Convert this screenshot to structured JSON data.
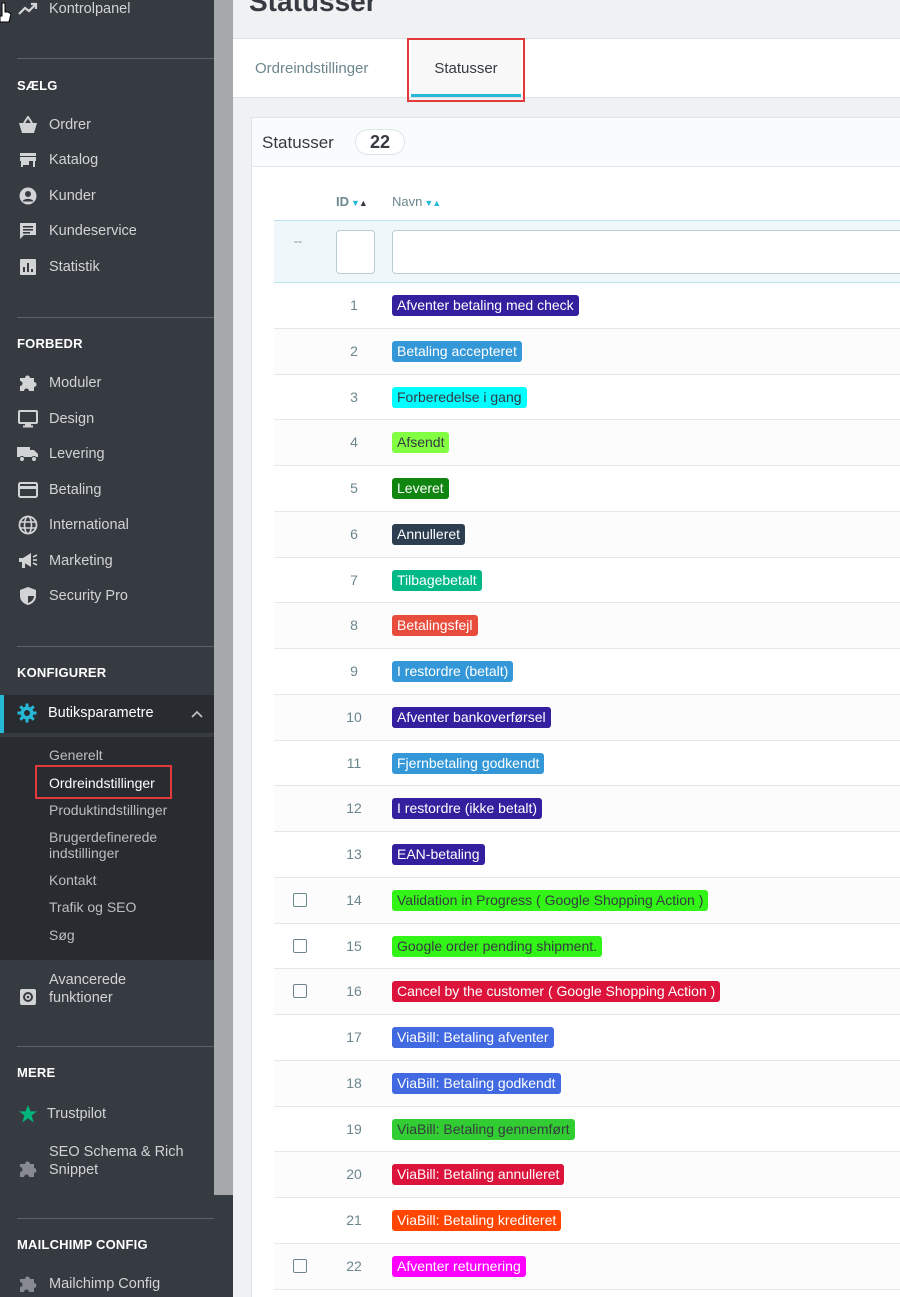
{
  "page": {
    "title": "Statusser"
  },
  "tabs": [
    {
      "label": "Ordreindstillinger"
    },
    {
      "label": "Statusser"
    }
  ],
  "sidebar": {
    "top_item": {
      "label": "Kontrolpanel",
      "icon": "trending-up-icon"
    },
    "sections": [
      {
        "title": "SÆLG",
        "items": [
          {
            "label": "Ordrer",
            "icon": "basket-icon"
          },
          {
            "label": "Katalog",
            "icon": "store-icon"
          },
          {
            "label": "Kunder",
            "icon": "account-icon"
          },
          {
            "label": "Kundeservice",
            "icon": "chat-icon"
          },
          {
            "label": "Statistik",
            "icon": "bar-chart-icon"
          }
        ]
      },
      {
        "title": "FORBEDR",
        "items": [
          {
            "label": "Moduler",
            "icon": "puzzle-icon"
          },
          {
            "label": "Design",
            "icon": "desktop-icon"
          },
          {
            "label": "Levering",
            "icon": "truck-icon"
          },
          {
            "label": "Betaling",
            "icon": "credit-card-icon"
          },
          {
            "label": "International",
            "icon": "globe-icon"
          },
          {
            "label": "Marketing",
            "icon": "megaphone-icon"
          },
          {
            "label": "Security Pro",
            "icon": "shield-icon"
          }
        ]
      },
      {
        "title": "KONFIGURER"
      },
      {
        "title": "MERE",
        "items": [
          {
            "label": "Trustpilot",
            "icon": "star-icon"
          },
          {
            "label": "SEO Schema & Rich Snippet",
            "icon": "puzzle-icon"
          }
        ]
      },
      {
        "title": "MAILCHIMP CONFIG",
        "items": [
          {
            "label": "Mailchimp Config",
            "icon": "puzzle-icon"
          }
        ]
      }
    ],
    "active": {
      "label": "Butiksparametre",
      "icon": "gear-icon"
    },
    "subitems": [
      "Generelt",
      "Ordreindstillinger",
      "Produktindstillinger",
      "Brugerdefinerede indstillinger",
      "Kontakt",
      "Trafik og SEO",
      "Søg"
    ],
    "advanced": {
      "label": "Avancerede funktioner",
      "icon": "settings-box-icon"
    }
  },
  "panel": {
    "title": "Statusser",
    "count": "22"
  },
  "table": {
    "columns": [
      "ID",
      "Navn"
    ],
    "filter_placeholder": "--",
    "rows": [
      {
        "id": "1",
        "name": "Afventer betaling med check",
        "color": "#34209e",
        "text": "#ffffff",
        "checkbox": false
      },
      {
        "id": "2",
        "name": "Betaling accepteret",
        "color": "#3498d8",
        "text": "#ffffff",
        "checkbox": false
      },
      {
        "id": "3",
        "name": "Forberedelse i gang",
        "color": "#00ffff",
        "text": "#363a41",
        "checkbox": false
      },
      {
        "id": "4",
        "name": "Afsendt",
        "color": "#82ff40",
        "text": "#363a41",
        "checkbox": false
      },
      {
        "id": "5",
        "name": "Leveret",
        "color": "#108510",
        "text": "#ffffff",
        "checkbox": false
      },
      {
        "id": "6",
        "name": "Annulleret",
        "color": "#2c3e50",
        "text": "#ffffff",
        "checkbox": false
      },
      {
        "id": "7",
        "name": "Tilbagebetalt",
        "color": "#01b887",
        "text": "#ffffff",
        "checkbox": false
      },
      {
        "id": "8",
        "name": "Betalingsfejl",
        "color": "#e74c3c",
        "text": "#ffffff",
        "checkbox": false
      },
      {
        "id": "9",
        "name": "I restordre (betalt)",
        "color": "#3498d8",
        "text": "#ffffff",
        "checkbox": false
      },
      {
        "id": "10",
        "name": "Afventer bankoverførsel",
        "color": "#34209e",
        "text": "#ffffff",
        "checkbox": false
      },
      {
        "id": "11",
        "name": "Fjernbetaling godkendt",
        "color": "#3498d8",
        "text": "#ffffff",
        "checkbox": false
      },
      {
        "id": "12",
        "name": "I restordre (ikke betalt)",
        "color": "#34209e",
        "text": "#ffffff",
        "checkbox": false
      },
      {
        "id": "13",
        "name": "EAN-betaling",
        "color": "#34209e",
        "text": "#ffffff",
        "checkbox": false
      },
      {
        "id": "14",
        "name": "Validation in Progress ( Google Shopping Action )",
        "color": "#32f416",
        "text": "#363a41",
        "checkbox": true
      },
      {
        "id": "15",
        "name": "Google order pending shipment.",
        "color": "#32f416",
        "text": "#363a41",
        "checkbox": true
      },
      {
        "id": "16",
        "name": "Cancel by the customer ( Google Shopping Action )",
        "color": "#dc143c",
        "text": "#ffffff",
        "checkbox": true
      },
      {
        "id": "17",
        "name": "ViaBill: Betaling afventer",
        "color": "#4169e1",
        "text": "#ffffff",
        "checkbox": false
      },
      {
        "id": "18",
        "name": "ViaBill: Betaling godkendt",
        "color": "#4169e1",
        "text": "#ffffff",
        "checkbox": false
      },
      {
        "id": "19",
        "name": "ViaBill: Betaling gennemført",
        "color": "#32cd32",
        "text": "#363a41",
        "checkbox": false
      },
      {
        "id": "20",
        "name": "ViaBill: Betaling annulleret",
        "color": "#dc143c",
        "text": "#ffffff",
        "checkbox": false
      },
      {
        "id": "21",
        "name": "ViaBill: Betaling krediteret",
        "color": "#ff4500",
        "text": "#ffffff",
        "checkbox": false
      },
      {
        "id": "22",
        "name": "Afventer returnering",
        "color": "#ff00ff",
        "text": "#ffffff",
        "checkbox": true
      }
    ]
  }
}
